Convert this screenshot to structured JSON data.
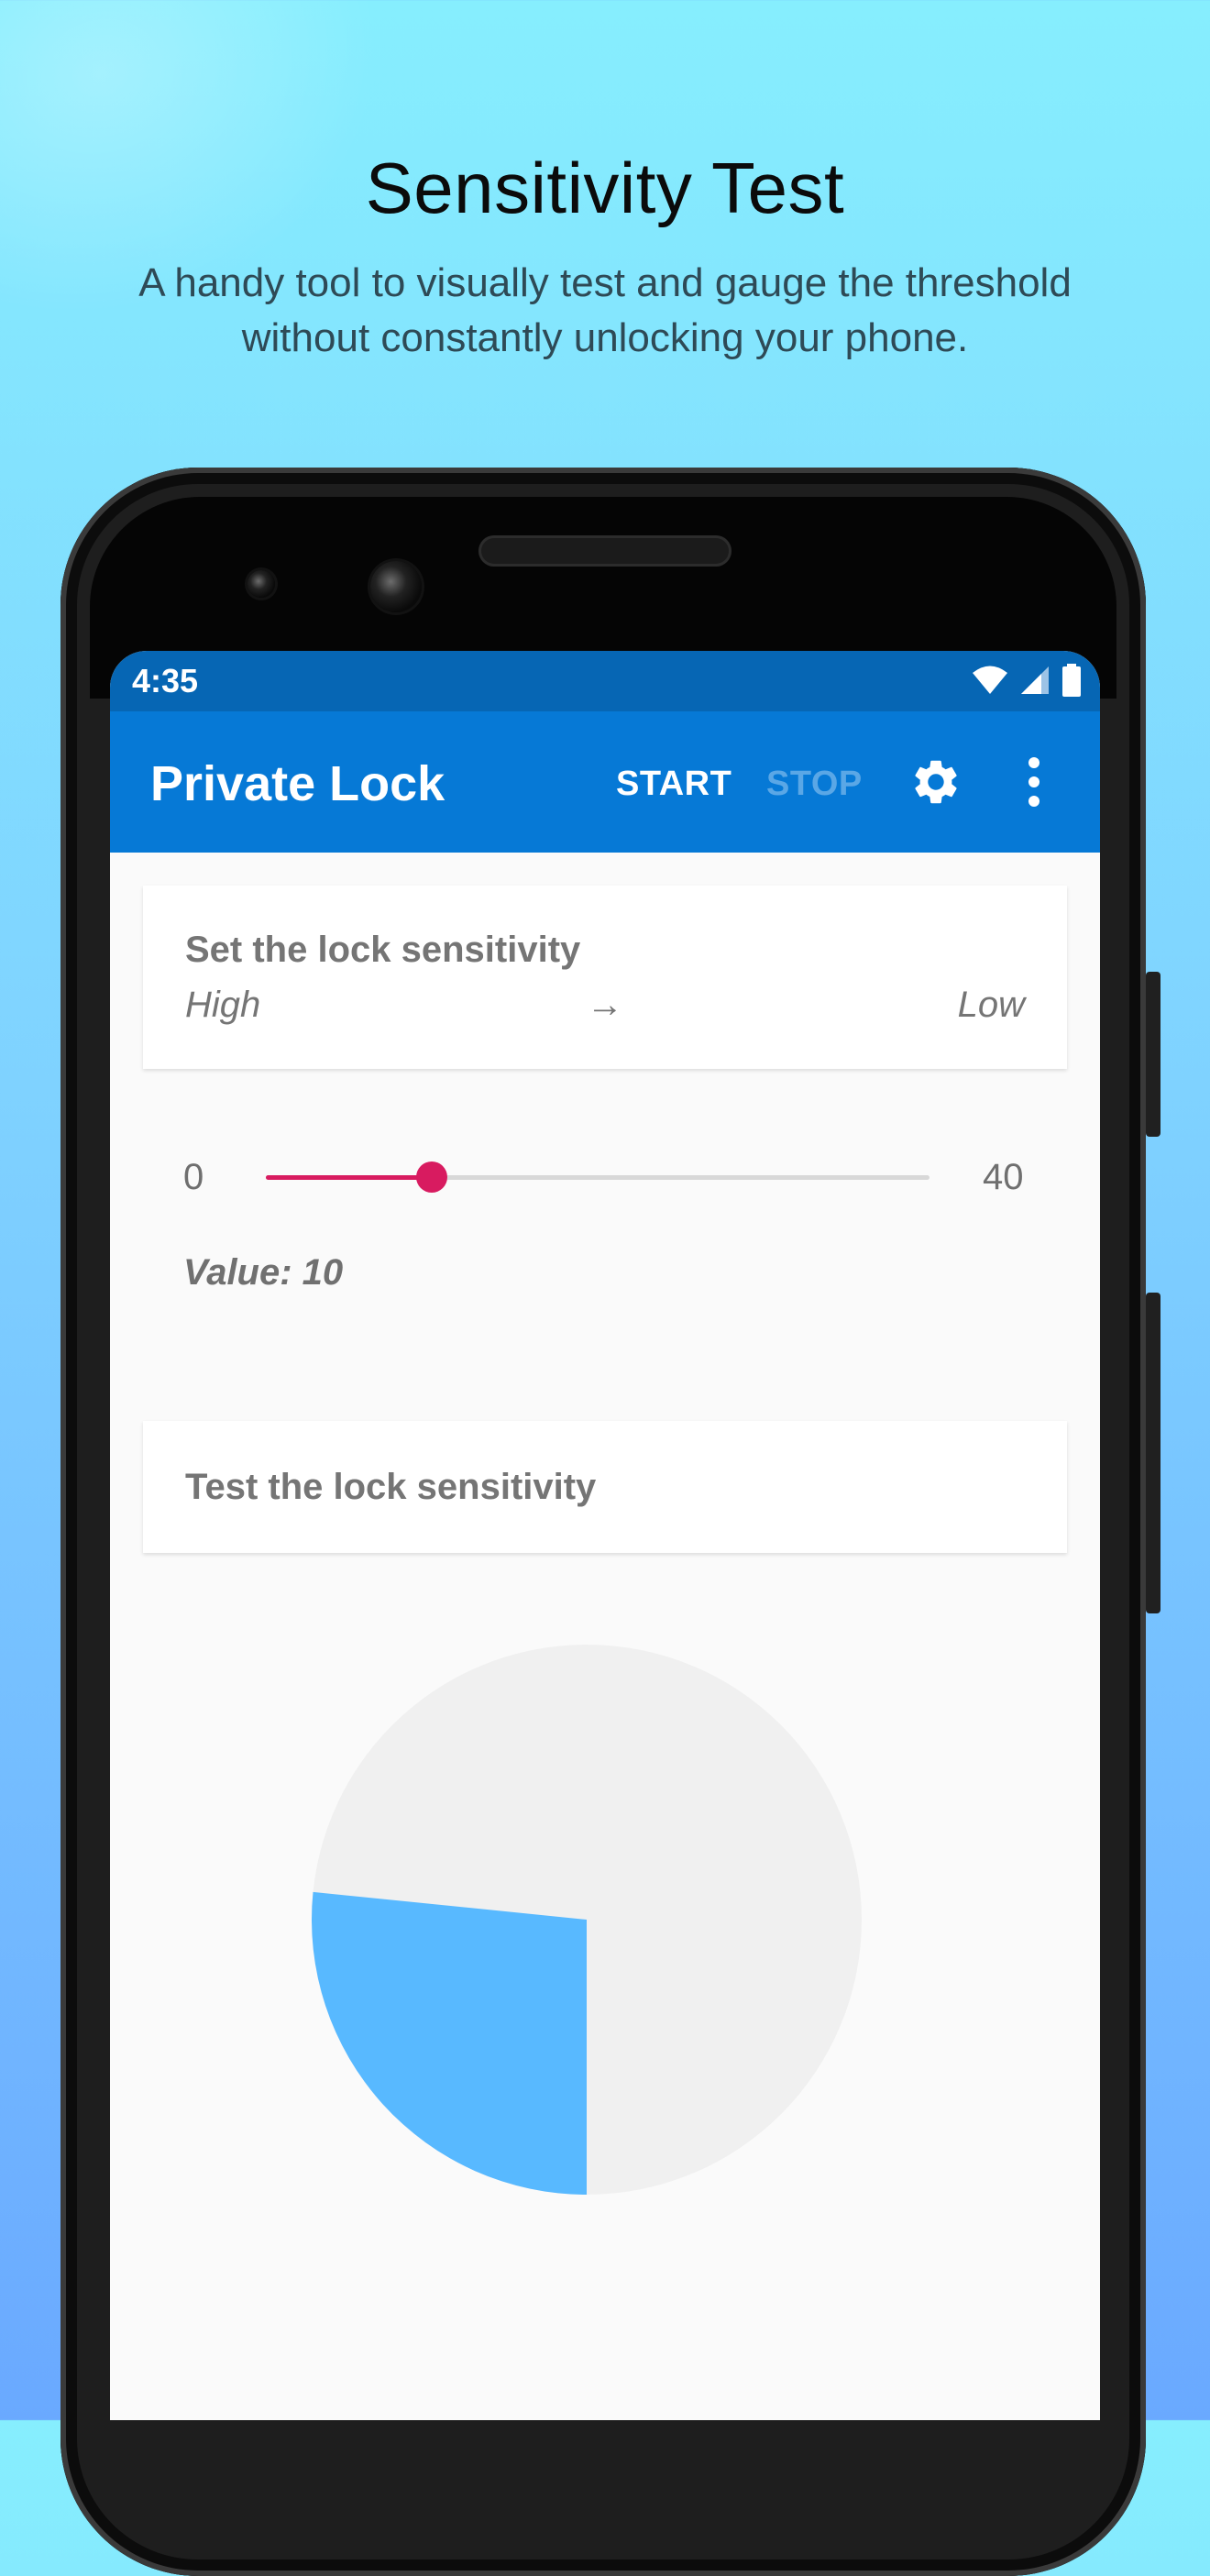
{
  "hero": {
    "title": "Sensitivity Test",
    "subtitle": "A handy tool to visually test and gauge the threshold without constantly unlocking your phone."
  },
  "status_bar": {
    "time": "4:35",
    "icons": [
      "wifi-icon",
      "cellular-signal-icon",
      "battery-icon"
    ]
  },
  "app_bar": {
    "title": "Private Lock",
    "start_label": "START",
    "stop_label": "STOP",
    "stop_enabled": false,
    "settings_icon": "gear-icon",
    "overflow_icon": "more-vert-icon"
  },
  "sensitivity_card": {
    "title": "Set the lock sensitivity",
    "high_label": "High",
    "arrow": "→",
    "low_label": "Low"
  },
  "slider": {
    "min_label": "0",
    "max_label": "40",
    "min": 0,
    "max": 40,
    "value": 10,
    "value_text": "Value: 10"
  },
  "test_card": {
    "title": "Test the lock sensitivity"
  },
  "gauge": {
    "fill_fraction": 0.266,
    "colors": {
      "background": "#f0f0f0",
      "fill": "#58b9ff"
    }
  },
  "colors": {
    "status_bar": "#0666b4",
    "app_bar": "#0679d6",
    "accent": "#d81b60",
    "stop_disabled": "#5aa7e6"
  }
}
